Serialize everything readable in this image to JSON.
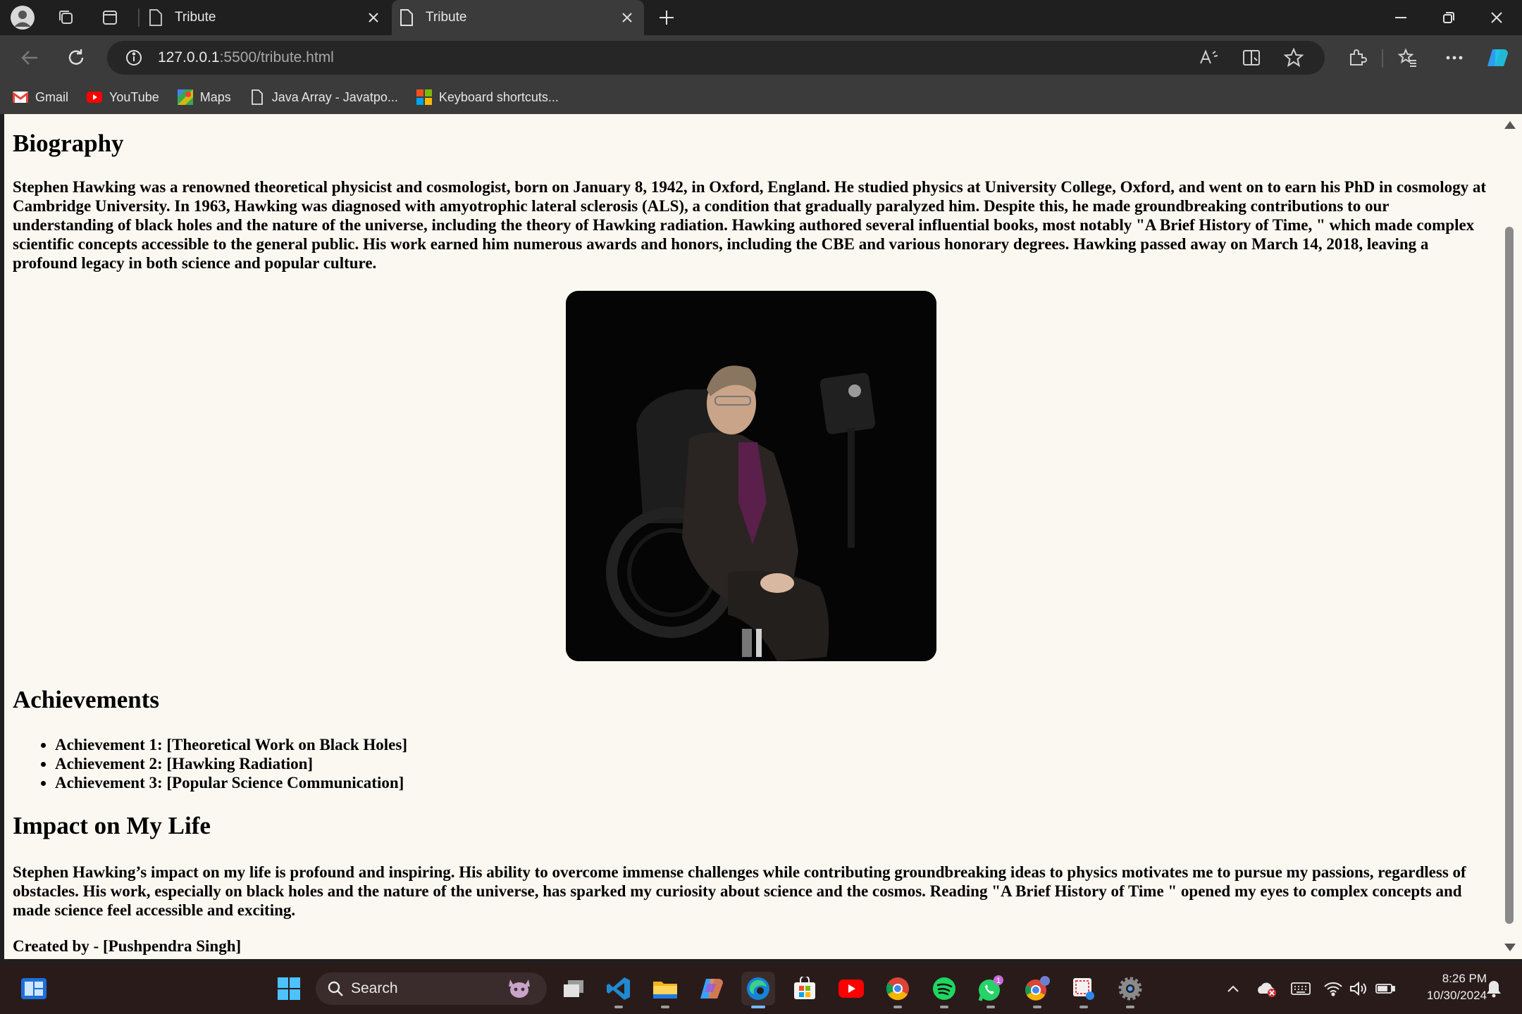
{
  "browser": {
    "tabs": [
      {
        "title": "Tribute",
        "active": false
      },
      {
        "title": "Tribute",
        "active": true
      }
    ],
    "address": {
      "host": "127.0.0.1",
      "path": ":5500/tribute.html"
    },
    "bookmarks": [
      {
        "label": "Gmail",
        "icon": "gmail-icon"
      },
      {
        "label": "YouTube",
        "icon": "youtube-icon"
      },
      {
        "label": "Maps",
        "icon": "maps-icon"
      },
      {
        "label": "Java Array - Javatpo...",
        "icon": "page-icon"
      },
      {
        "label": "Keyboard shortcuts...",
        "icon": "microsoft-icon"
      }
    ]
  },
  "page": {
    "biography_heading": "Biography",
    "biography_text": "Stephen Hawking was a renowned theoretical physicist and cosmologist, born on January 8, 1942, in Oxford, England. He studied physics at University College, Oxford, and went on to earn his PhD in cosmology at Cambridge University. In 1963, Hawking was diagnosed with amyotrophic lateral sclerosis (ALS), a condition that gradually paralyzed him. Despite this, he made groundbreaking contributions to our understanding of black holes and the nature of the universe, including the theory of Hawking radiation. Hawking authored several influential books, most notably \"A Brief History of Time, \" which made complex scientific concepts accessible to the general public. His work earned him numerous awards and honors, including the CBE and various honorary degrees. Hawking passed away on March 14, 2018, leaving a profound legacy in both science and popular culture.",
    "achievements_heading": "Achievements",
    "achievements": [
      "Achievement 1: [Theoretical Work on Black Holes]",
      "Achievement 2: [Hawking Radiation]",
      "Achievement 3: [Popular Science Communication]"
    ],
    "impact_heading": "Impact on My Life",
    "impact_text": "Stephen Hawking’s impact on my life is profound and inspiring. His ability to overcome immense challenges while contributing groundbreaking ideas to physics motivates me to pursue my passions, regardless of obstacles. His work, especially on black holes and the nature of the universe, has sparked my curiosity about science and the cosmos. Reading \"A Brief History of Time \" opened my eyes to complex concepts and made science feel accessible and exciting.",
    "created_by": "Created by - [Pushpendra Singh]"
  },
  "taskbar": {
    "search_label": "Search",
    "clock_time": "8:26 PM",
    "clock_date": "10/30/2024",
    "whatsapp_badge": "1"
  },
  "colors": {
    "page_bg": "#faf8f1",
    "chrome_dark": "#1f1f1f",
    "chrome_mid": "#3b3b3b",
    "taskbar_bg": "#2a1b1b"
  }
}
